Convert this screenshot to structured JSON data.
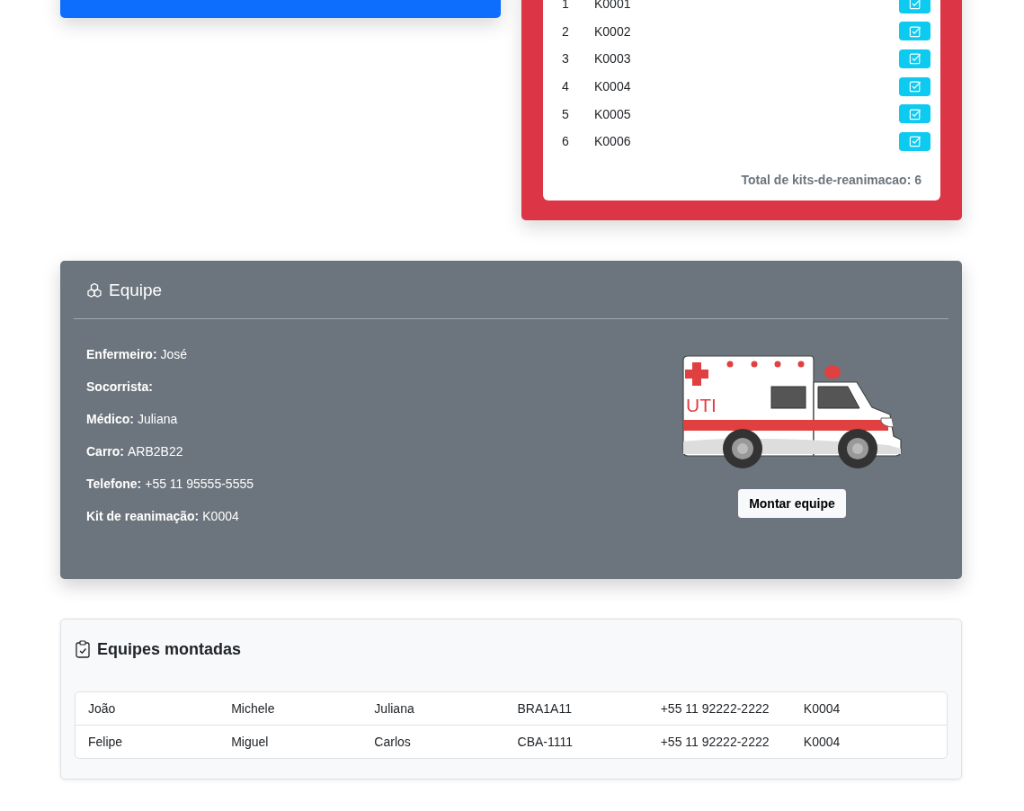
{
  "kits": {
    "rows": [
      {
        "number": "1",
        "code": "K0001"
      },
      {
        "number": "2",
        "code": "K0002"
      },
      {
        "number": "3",
        "code": "K0003"
      },
      {
        "number": "4",
        "code": "K0004"
      },
      {
        "number": "5",
        "code": "K0005"
      },
      {
        "number": "6",
        "code": "K0006"
      }
    ],
    "total": "Total de kits-de-reanimacao: 6"
  },
  "equipe": {
    "title": "Equipe",
    "fields": [
      {
        "label": "Enfermeiro:",
        "value": "José"
      },
      {
        "label": "Socorrista:"
      },
      {
        "label": "Médico:",
        "value": "Juliana"
      },
      {
        "label": "Carro:",
        "value": "ARB2B22"
      },
      {
        "label": "Telefone:",
        "value": "+55 11 95555-5555"
      },
      {
        "label": "Kit de reanimação:",
        "value": "K0004"
      }
    ],
    "vehicle_label": "UTI",
    "button": "Montar equipe"
  },
  "equipes_montadas": {
    "title": "Equipes montadas",
    "rows": [
      [
        "João",
        "Michele",
        "Juliana",
        "BRA1A11",
        "+55 11 92222-2222",
        "K0004"
      ],
      [
        "Felipe",
        "Miguel",
        "Carlos",
        "CBA-1111",
        "+55 11 92222-2222",
        "K0004"
      ]
    ]
  }
}
